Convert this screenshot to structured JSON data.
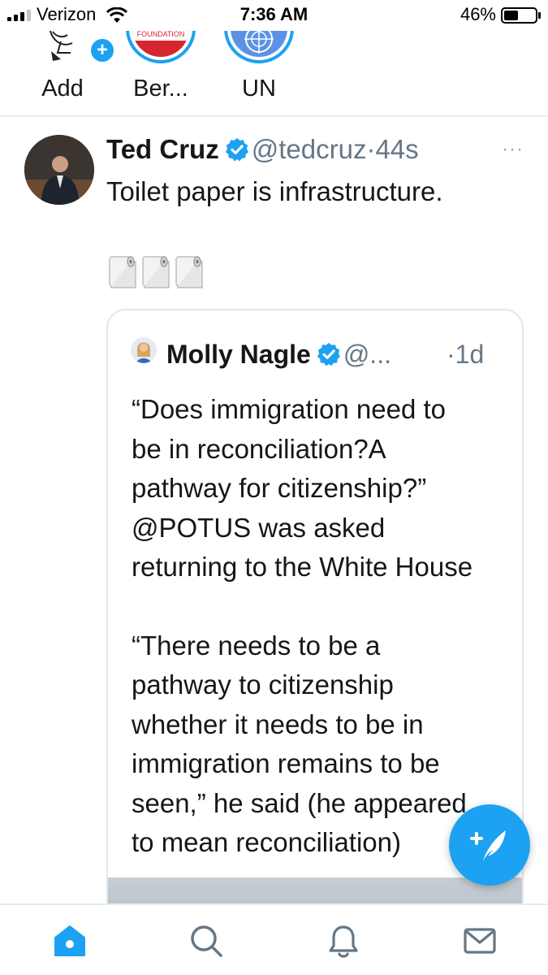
{
  "status_bar": {
    "carrier": "Verizon",
    "time": "7:36 AM",
    "battery": "46%",
    "battery_level": 0.46
  },
  "fleets": [
    {
      "label": "Add",
      "icon": "add-plus-icon"
    },
    {
      "label": "Ber...",
      "avatar_text": "FOUNDATION"
    },
    {
      "label": "UN"
    }
  ],
  "tweet": {
    "name": "Ted Cruz",
    "handle": "@tedcruz",
    "separator": "·",
    "time": "44s",
    "more": "···",
    "text": "Toilet paper is infrastructure.",
    "emoji": "🧻🧻🧻",
    "quote": {
      "name": "Molly Nagle",
      "handle": "@...",
      "separator": "·",
      "time": "1d",
      "paragraph1": "“Does immigration need to\nbe in reconciliation?A\npathway for citizenship?”\n@POTUS was asked\nreturning to the White House",
      "paragraph2": "“There needs to be a\npathway to citizenship\nwhether it needs to be in\nimmigration remains to be\nseen,” he said (he appeared\nto mean reconciliation)"
    }
  },
  "tabbar": {
    "tabs": [
      {
        "name": "home",
        "icon": "home-icon",
        "active": true
      },
      {
        "name": "search",
        "icon": "search-icon",
        "active": false
      },
      {
        "name": "notifications",
        "icon": "bell-icon",
        "active": false
      },
      {
        "name": "messages",
        "icon": "envelope-icon",
        "active": false
      }
    ]
  },
  "colors": {
    "accent": "#1da1f2",
    "text": "#14171a",
    "secondary_text": "#657786",
    "divider": "#e6ecf0"
  }
}
